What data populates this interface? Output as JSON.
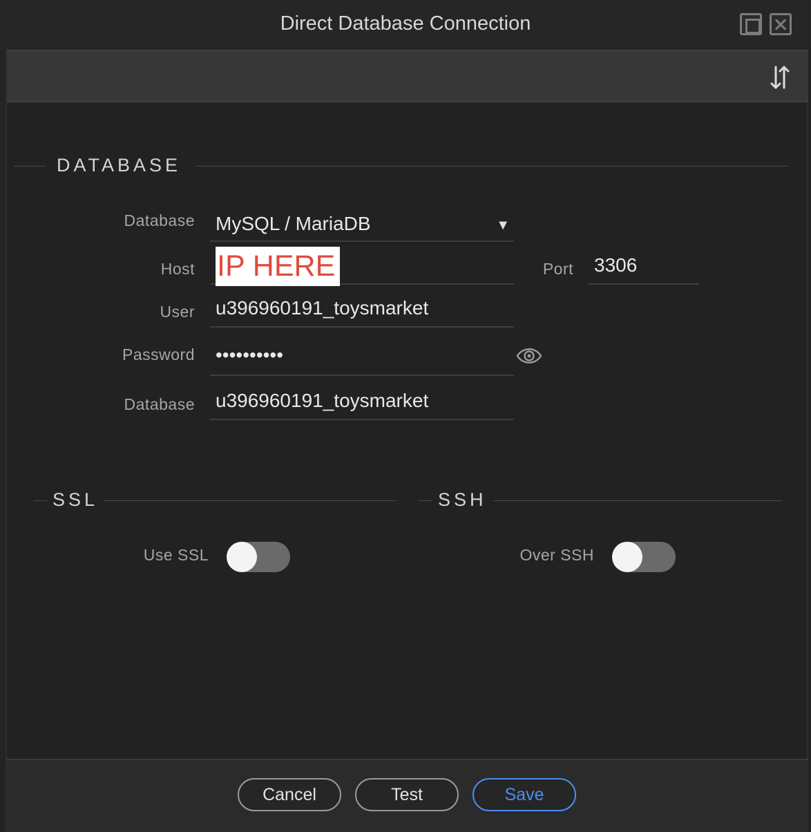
{
  "window": {
    "title": "Direct Database Connection"
  },
  "toolbar": {
    "sort_icon": "sort-arrows-icon"
  },
  "database_section": {
    "title": "DATABASE",
    "database_type_label": "Database",
    "database_type_value": "MySQL / MariaDB",
    "host_label": "Host",
    "host_redaction_text": "IP HERE",
    "port_label": "Port",
    "port_value": "3306",
    "user_label": "User",
    "user_value": "u396960191_toysmarket",
    "password_label": "Password",
    "password_value": "••••••••••",
    "database_name_label": "Database",
    "database_name_value": "u396960191_toysmarket"
  },
  "ssl_section": {
    "title": "SSL",
    "use_ssl_label": "Use SSL",
    "use_ssl_enabled": false
  },
  "ssh_section": {
    "title": "SSH",
    "over_ssh_label": "Over SSH",
    "over_ssh_enabled": false
  },
  "footer": {
    "cancel_label": "Cancel",
    "test_label": "Test",
    "save_label": "Save"
  },
  "colors": {
    "accent": "#4a8ff0",
    "redaction_text": "#e04b3c",
    "background": "#222222"
  }
}
